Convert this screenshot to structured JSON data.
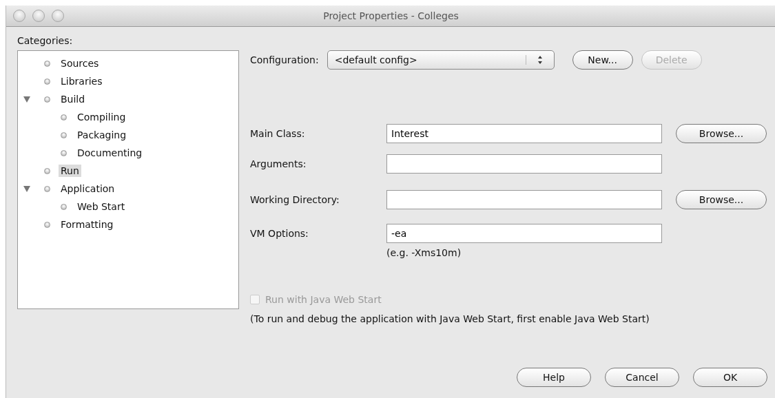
{
  "window": {
    "title": "Project Properties - Colleges"
  },
  "categories": {
    "label": "Categories:",
    "items": [
      {
        "label": "Sources",
        "selected": false
      },
      {
        "label": "Libraries",
        "selected": false
      },
      {
        "label": "Build",
        "selected": false,
        "expanded": true,
        "children": [
          {
            "label": "Compiling",
            "selected": false
          },
          {
            "label": "Packaging",
            "selected": false
          },
          {
            "label": "Documenting",
            "selected": false
          }
        ]
      },
      {
        "label": "Run",
        "selected": true
      },
      {
        "label": "Application",
        "selected": false,
        "expanded": true,
        "children": [
          {
            "label": "Web Start",
            "selected": false
          }
        ]
      },
      {
        "label": "Formatting",
        "selected": false
      }
    ]
  },
  "configuration": {
    "label": "Configuration:",
    "value": "<default config>",
    "buttons": [
      {
        "label": "New...",
        "disabled": false
      },
      {
        "label": "Delete",
        "disabled": true
      }
    ]
  },
  "fields": [
    {
      "label": "Main Class:",
      "value": "Interest",
      "button": "Browse..."
    },
    {
      "label": "Arguments:"
    },
    {
      "label": "Working Directory:",
      "button": "Browse..."
    },
    {
      "label": "VM Options:",
      "value": "-ea",
      "hint": "(e.g. -Xms10m)"
    }
  ],
  "web_start": {
    "label": "Run with Java Web Start",
    "checked": false,
    "disabled": true,
    "note": "(To run and debug the application with Java Web Start, first enable Java Web Start)"
  },
  "buttons": [
    {
      "label": "Help"
    },
    {
      "label": "Cancel"
    },
    {
      "label": "OK"
    }
  ]
}
